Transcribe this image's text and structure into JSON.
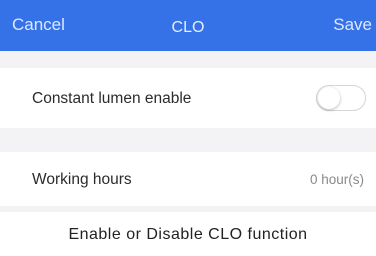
{
  "nav": {
    "cancel_label": "Cancel",
    "title": "CLO",
    "save_label": "Save"
  },
  "settings": {
    "constant_lumen": {
      "label": "Constant lumen enable",
      "enabled": false
    },
    "working_hours": {
      "label": "Working hours",
      "value": "0 hour(s)"
    }
  },
  "caption": "Enable or Disable CLO function",
  "colors": {
    "nav_background": "#3572e8",
    "section_gap": "#f3f3f5"
  }
}
